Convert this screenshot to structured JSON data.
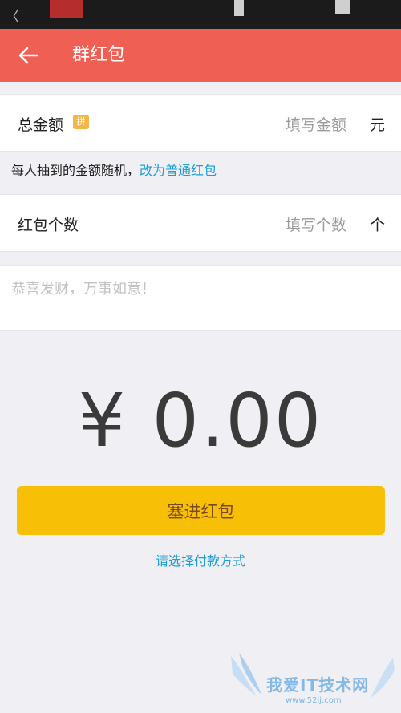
{
  "title_bar": {
    "title": "群红包"
  },
  "total_amount": {
    "label": "总金额",
    "badge": "拼",
    "placeholder": "填写金额",
    "unit": "元"
  },
  "hint": {
    "text": "每人抽到的金额随机，",
    "link": "改为普通红包"
  },
  "count": {
    "label": "红包个数",
    "placeholder": "填写个数",
    "unit": "个"
  },
  "message": {
    "placeholder": "恭喜发财，万事如意！"
  },
  "amount_display": "¥ 0.00",
  "submit_button": "塞进红包",
  "pay_method_link": "请选择付款方式",
  "watermark": {
    "text": "我爱IT技术网",
    "url": "www.52ij.com"
  },
  "colors": {
    "header": "#ef5f54",
    "button": "#f8bf07",
    "link": "#1b9ed6",
    "badge": "#f3b64b"
  }
}
